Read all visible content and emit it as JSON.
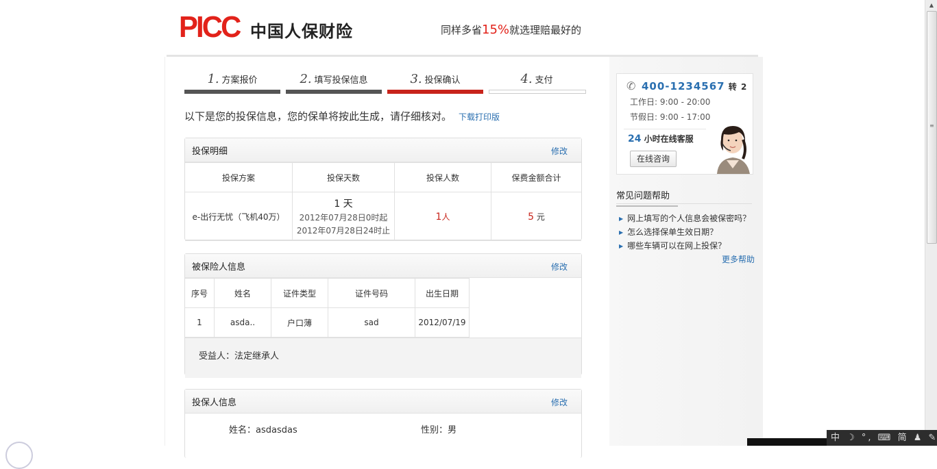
{
  "header": {
    "logo_text": "PICC",
    "logo_cn": "中国人保财险",
    "slogan_pre": "同样多省",
    "slogan_pct": "15%",
    "slogan_post": "就选理赔最好的"
  },
  "steps": [
    {
      "num": "1.",
      "label": "方案报价",
      "state": "done"
    },
    {
      "num": "2.",
      "label": "填写投保信息",
      "state": "done"
    },
    {
      "num": "3.",
      "label": "投保确认",
      "state": "active"
    },
    {
      "num": "4.",
      "label": "支付",
      "state": "pending"
    }
  ],
  "intro": {
    "text": "以下是您的投保信息，您的保单将按此生成，请仔细核对。",
    "download_link": "下载打印版"
  },
  "policy": {
    "title": "投保明细",
    "edit": "修改",
    "headers": [
      "投保方案",
      "投保天数",
      "投保人数",
      "保费金额合计"
    ],
    "plan": "e-出行无忧（飞机40万）",
    "days": "1 天",
    "start": "2012年07月28日0时起",
    "end": "2012年07月28日24时止",
    "persons_num": "1",
    "persons_unit": "人",
    "amount_num": "5",
    "amount_unit": " 元"
  },
  "insured": {
    "title": "被保险人信息",
    "edit": "修改",
    "headers": [
      "序号",
      "姓名",
      "证件类型",
      "证件号码",
      "出生日期"
    ],
    "row": [
      "1",
      "asda..",
      "户口薄",
      "sad",
      "2012/07/19"
    ],
    "beneficiary": "受益人：法定继承人"
  },
  "applicant": {
    "title": "投保人信息",
    "edit": "修改",
    "name": "姓名：asdasdas",
    "gender_label": "性别：",
    "gender": "男"
  },
  "sidebar": {
    "phone": "400-1234567",
    "phone_ext": " 转 2",
    "workday": "工作日: 9:00 - 20:00",
    "holiday": "节假日: 9:00 - 17:00",
    "online_num": "24",
    "online_text": " 小时在线客服",
    "chat_button": "在线咨询",
    "faq_title": "常见问题帮助",
    "faq": [
      "网上填写的个人信息会被保密吗？",
      "怎么选择保单生效日期？",
      "哪些车辆可以在网上投保？"
    ],
    "more": "更多帮助"
  },
  "ime": "中 ☽ °, ⌨ 简 ♟ ✎",
  "colors": {
    "accent": "#c8241b",
    "link": "#2a6fb0",
    "brand": "#e2221a"
  }
}
